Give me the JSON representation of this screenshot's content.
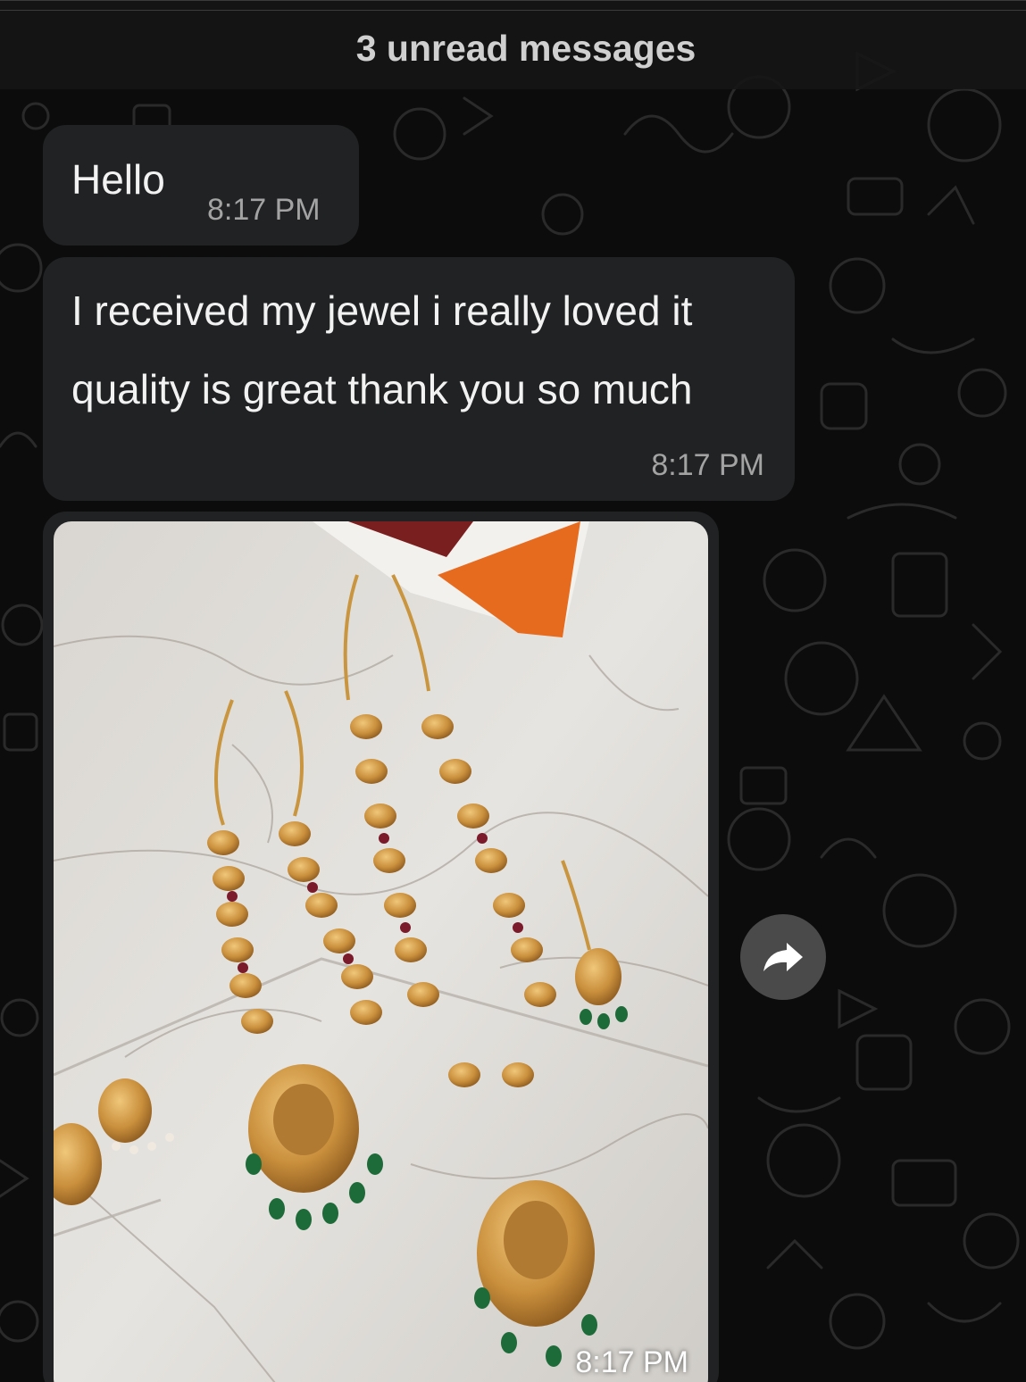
{
  "unread_banner": {
    "text": "3 unread messages"
  },
  "messages": [
    {
      "text": "Hello",
      "time": "8:17 PM"
    },
    {
      "lines": [
        "I received my jewel i really loved it",
        "quality is great thank you so much"
      ],
      "time": "8:17 PM"
    },
    {
      "type": "image",
      "image_content": "jewellery-set-on-marble-photo",
      "time": "8:17 PM"
    }
  ],
  "icons": {
    "forward": "forward-arrow-icon"
  },
  "colors": {
    "background": "#0c0c0c",
    "bubble": "#202224",
    "text": "#f2f2f2",
    "timestamp": "#a3a3a3",
    "forward_button": "#4a4a4a"
  }
}
